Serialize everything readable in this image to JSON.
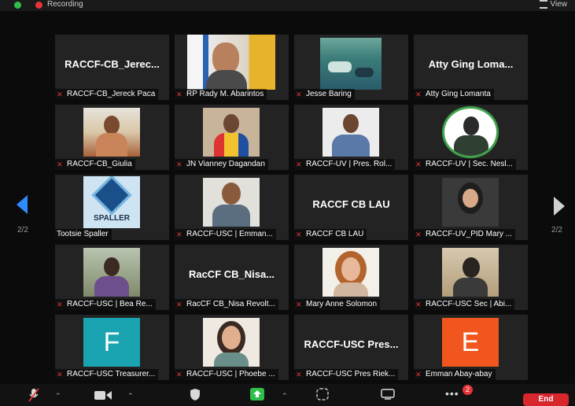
{
  "topbar": {
    "recording_label": "Recording",
    "view_label": "View"
  },
  "pager": {
    "left": "2/2",
    "right": "2/2"
  },
  "tiles": [
    {
      "name": "RACCF-CB_Jereck Paca",
      "big": "RACCF-CB_Jerec..."
    },
    {
      "name": "RP Rady M. Abarintos",
      "big": ""
    },
    {
      "name": "Jesse Baring",
      "big": ""
    },
    {
      "name": "Atty Ging Lomanta",
      "big": "Atty Ging Loma..."
    },
    {
      "name": "RACCF-CB_Giulia",
      "big": ""
    },
    {
      "name": "JN Vianney Dagandan",
      "big": ""
    },
    {
      "name": "RACCF-UV | Pres. Rol...",
      "big": ""
    },
    {
      "name": "RACCF-UV | Sec. Nesl...",
      "big": ""
    },
    {
      "name": "Tootsie Spaller",
      "big": ""
    },
    {
      "name": "RACCF-USC | Emman...",
      "big": ""
    },
    {
      "name": "RACCF CB LAU",
      "big": "RACCF CB LAU"
    },
    {
      "name": "RACCF-UV_PID Mary ...",
      "big": ""
    },
    {
      "name": "RACCF-USC | Bea Re...",
      "big": ""
    },
    {
      "name": "RacCF CB_Nisa Revolt...",
      "big": "RacCF CB_Nisa..."
    },
    {
      "name": "Mary Anne Solomon",
      "big": ""
    },
    {
      "name": "RACCF-USC Sec | Abi...",
      "big": ""
    },
    {
      "name": "RACCF-USC Treasurer...",
      "big": ""
    },
    {
      "name": "RACCF-USC | Phoebe ...",
      "big": ""
    },
    {
      "name": "RACCF-USC Pres Riek...",
      "big": "RACCF-USC Pres..."
    },
    {
      "name": "Emman Abay-abay",
      "big": ""
    }
  ],
  "avatars": {
    "letter_f": "F",
    "letter_e": "E",
    "logo_text": "SPALLER"
  },
  "toolbar": {
    "chat_badge": "2",
    "end_label": "End"
  },
  "colors": {
    "accent_blue": "#2d8cff",
    "muted_red": "#e5343a",
    "share_green": "#2fbf4a",
    "avatar_teal": "#1aa3b1",
    "avatar_orange": "#f0561d"
  }
}
